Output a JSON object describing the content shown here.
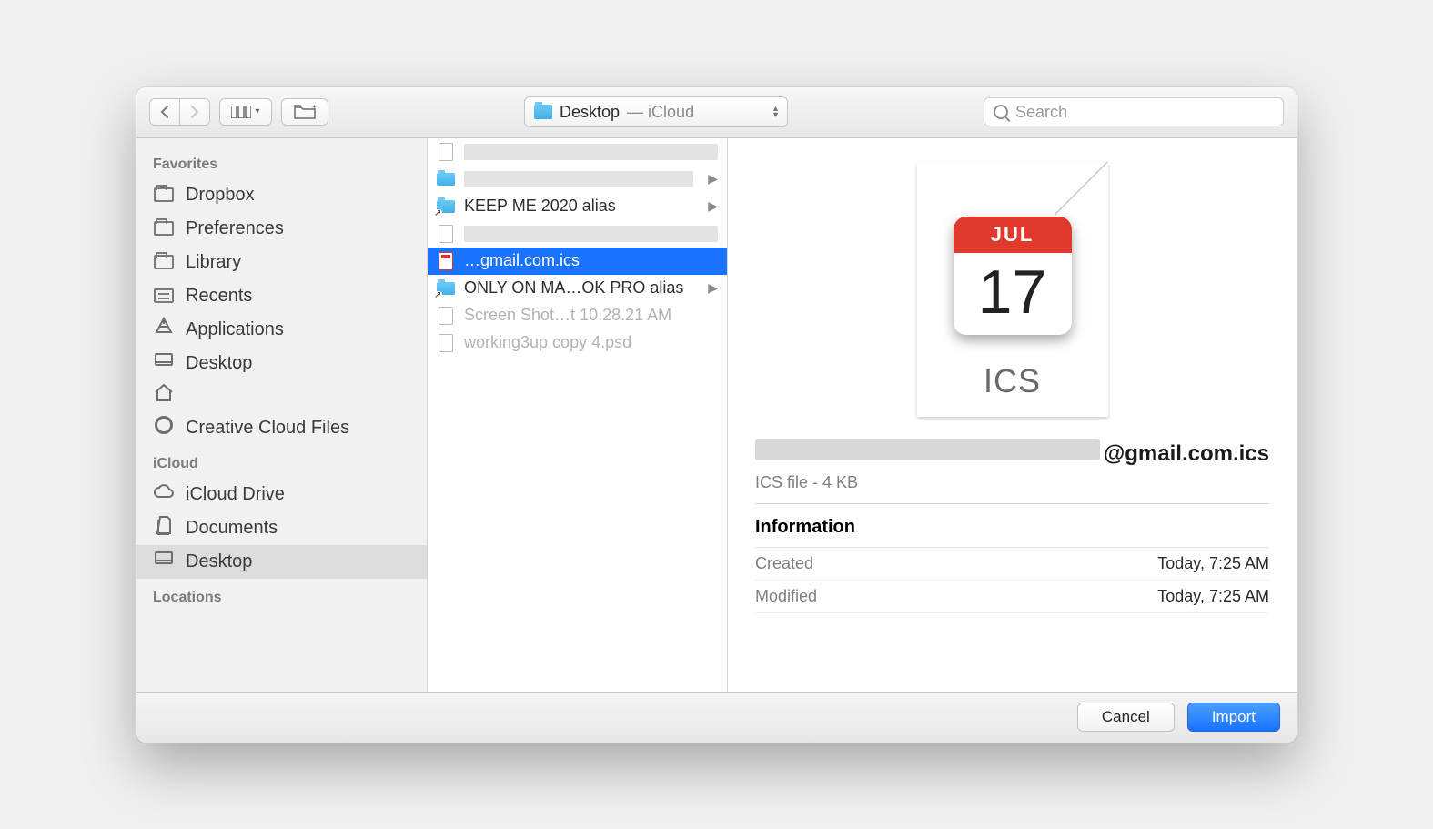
{
  "toolbar": {
    "location_main": "Desktop",
    "location_sub": " — iCloud",
    "search_placeholder": "Search"
  },
  "sidebar": {
    "sections": [
      {
        "title": "Favorites",
        "items": [
          {
            "icon": "folder",
            "label": "Dropbox"
          },
          {
            "icon": "folder",
            "label": "Preferences"
          },
          {
            "icon": "folder",
            "label": "Library"
          },
          {
            "icon": "recents",
            "label": "Recents"
          },
          {
            "icon": "apps",
            "label": "Applications"
          },
          {
            "icon": "desk",
            "label": "Desktop"
          },
          {
            "icon": "home",
            "label": "",
            "blurred": true
          },
          {
            "icon": "cc",
            "label": "Creative Cloud Files"
          }
        ]
      },
      {
        "title": "iCloud",
        "items": [
          {
            "icon": "cloud",
            "label": "iCloud Drive"
          },
          {
            "icon": "docs",
            "label": "Documents"
          },
          {
            "icon": "desk",
            "label": "Desktop",
            "selected": true
          }
        ]
      },
      {
        "title": "Locations",
        "items": []
      }
    ]
  },
  "files": [
    {
      "icon": "doc",
      "name": "",
      "blurred": true,
      "disabled": true
    },
    {
      "icon": "folder",
      "name": "",
      "blurred": true,
      "arrow": true
    },
    {
      "icon": "folder-alias",
      "name": "KEEP ME 2020 alias",
      "arrow": true
    },
    {
      "icon": "doc",
      "name": "",
      "blurred": true,
      "disabled": true
    },
    {
      "icon": "cal",
      "name": "…gmail.com.ics",
      "selected": true
    },
    {
      "icon": "folder-alias",
      "name": "ONLY ON MA…OK PRO alias",
      "arrow": true
    },
    {
      "icon": "doc",
      "name": "Screen Shot…t 10.28.21 AM",
      "disabled": true
    },
    {
      "icon": "doc",
      "name": "working3up copy 4.psd",
      "disabled": true
    }
  ],
  "preview": {
    "cal_month": "JUL",
    "cal_day": "17",
    "ext_badge": "ICS",
    "name_suffix": "@gmail.com.ics",
    "subtitle": "ICS file - 4 KB",
    "info_header": "Information",
    "rows": [
      {
        "k": "Created",
        "v": "Today, 7:25 AM"
      },
      {
        "k": "Modified",
        "v": "Today, 7:25 AM"
      }
    ]
  },
  "footer": {
    "cancel": "Cancel",
    "import": "Import"
  }
}
